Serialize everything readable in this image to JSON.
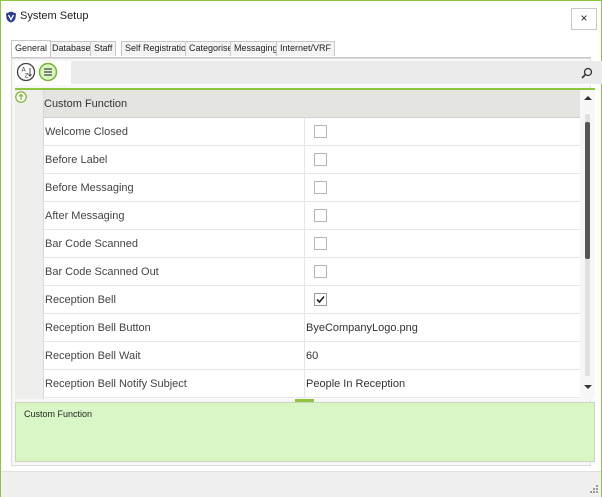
{
  "window": {
    "title": "System Setup",
    "close_label": "×",
    "accent_color": "#8cc63f"
  },
  "tabs": [
    {
      "label": "General",
      "active": true
    },
    {
      "label": "Database",
      "active": false
    },
    {
      "label": "Staff",
      "active": false
    },
    {
      "label": "Self Registration",
      "active": false
    },
    {
      "label": "Categorise",
      "active": false
    },
    {
      "label": "Messaging",
      "active": false
    },
    {
      "label": "Internet/VRF",
      "active": false
    }
  ],
  "toolbar": {
    "icons": [
      "sort-alphabetical-icon",
      "categorized-icon",
      "search-icon"
    ]
  },
  "grid": {
    "category": "Custom Function",
    "rows": [
      {
        "name": "Welcome Closed",
        "type": "checkbox",
        "checked": false
      },
      {
        "name": "Before Label",
        "type": "checkbox",
        "checked": false
      },
      {
        "name": "Before Messaging",
        "type": "checkbox",
        "checked": false
      },
      {
        "name": "After Messaging",
        "type": "checkbox",
        "checked": false
      },
      {
        "name": "Bar Code Scanned",
        "type": "checkbox",
        "checked": false
      },
      {
        "name": "Bar Code Scanned Out",
        "type": "checkbox",
        "checked": false
      },
      {
        "name": "Reception Bell",
        "type": "checkbox",
        "checked": true
      },
      {
        "name": "Reception Bell Button",
        "type": "text",
        "value": "ByeCompanyLogo.png"
      },
      {
        "name": "Reception Bell Wait",
        "type": "text",
        "value": "60"
      },
      {
        "name": "Reception Bell Notify Subject",
        "type": "text",
        "value": "People In Reception"
      }
    ]
  },
  "description": {
    "text": "Custom Function",
    "background": "#d9f7c6"
  }
}
